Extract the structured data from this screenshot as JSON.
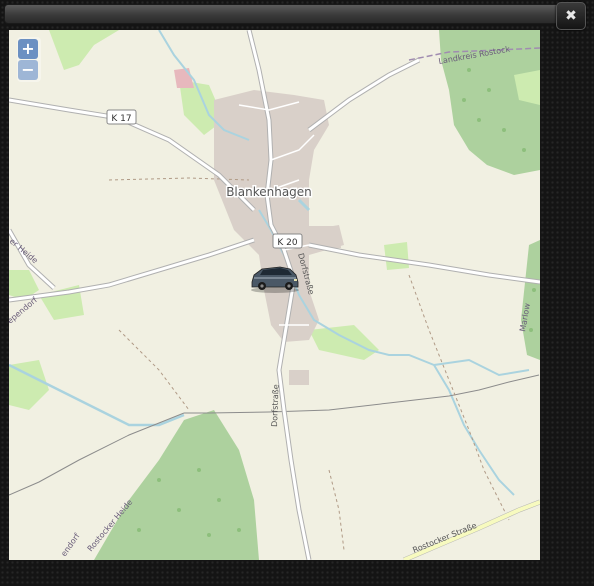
{
  "window": {
    "close_label": "✖"
  },
  "map": {
    "zoom_in_label": "+",
    "zoom_out_label": "−",
    "labels": {
      "town": "Blankenhagen",
      "k17": "K 17",
      "k20": "K 20",
      "dorfstrasse_north": "Dorfstraße",
      "dorfstrasse_south": "Dorfstraße",
      "heide_west": "er Heide",
      "dorf_west": "ependorf",
      "dorf_southwest": "endorf",
      "rostocker_heide": "Rostocker Heide",
      "rostocker_strasse": "Rostocker Straße",
      "landkreis": "Landkreis Rostock",
      "marlow": "Marlow"
    },
    "marker_icon": "car-icon",
    "colors": {
      "land": "#f1f0e2",
      "forest": "#add19e",
      "meadow": "#cdebb0",
      "water": "#aad3df",
      "road": "#ffffff",
      "road_casing": "#b0b0b0",
      "main_road": "#f7fabf",
      "built_up": "#d9d0c9",
      "boundary": "#8c8c8c"
    }
  }
}
